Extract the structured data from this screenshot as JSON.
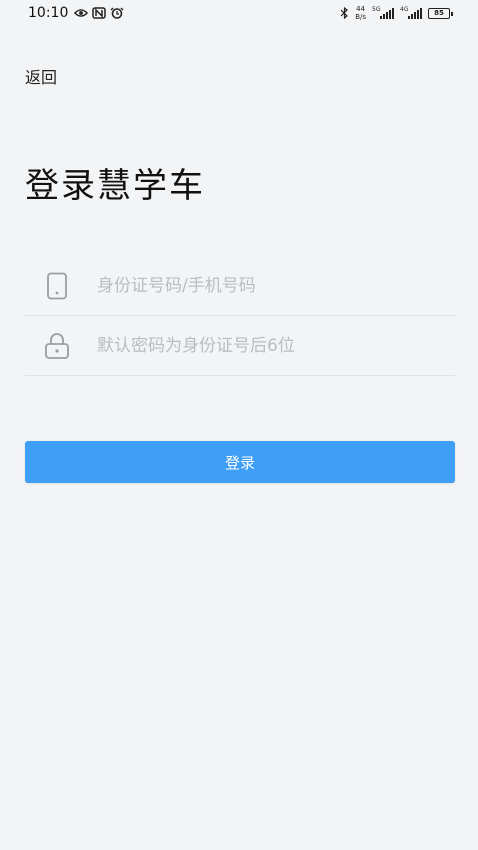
{
  "status_bar": {
    "time": "10:10",
    "net_speed_value": "44",
    "net_speed_unit": "B/s",
    "sim1_label": "5G",
    "sim2_label": "4G",
    "battery": "85"
  },
  "header": {
    "back_label": "返回"
  },
  "main": {
    "title": "登录慧学车",
    "account_placeholder": "身份证号码/手机号码",
    "password_placeholder": "默认密码为身份证号后6位",
    "login_label": "登录"
  },
  "colors": {
    "background": "#f3f4f6",
    "accent": "#3f9ef6",
    "placeholder": "#b9bcc2",
    "divider": "#e0e2e6"
  }
}
